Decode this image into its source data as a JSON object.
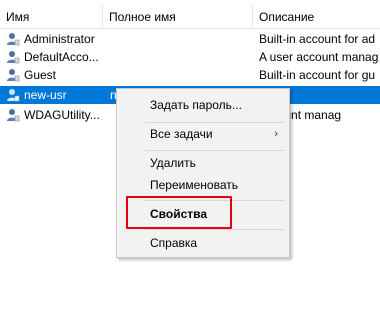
{
  "columns": {
    "name": "Имя",
    "full_name": "Полное имя",
    "description": "Описание"
  },
  "rows": [
    {
      "name": "Administrator",
      "full_name": "",
      "description": "Built-in account for ad"
    },
    {
      "name": "DefaultAcco...",
      "full_name": "",
      "description": "A user account manag"
    },
    {
      "name": "Guest",
      "full_name": "",
      "description": "Built-in account for gu"
    },
    {
      "name": "new-usr",
      "full_name": "n",
      "description": "",
      "selected": true
    },
    {
      "name": "WDAGUtility...",
      "full_name": "",
      "description": "account manag"
    }
  ],
  "context_menu": {
    "items": [
      {
        "label": "Задать пароль..."
      },
      {
        "label": "Все задачи",
        "submenu": true,
        "chevron": "›"
      },
      {
        "label": "Удалить"
      },
      {
        "label": "Переименовать"
      },
      {
        "label": "Свойства",
        "bold": true,
        "highlighted": true
      },
      {
        "label": "Справка"
      }
    ]
  },
  "icons": {
    "user": "user-icon",
    "chevron": "chevron-right-icon"
  },
  "colors": {
    "selection": "#0078d7",
    "highlight_box": "#e8000f",
    "menu_bg": "#f2f2f2"
  }
}
